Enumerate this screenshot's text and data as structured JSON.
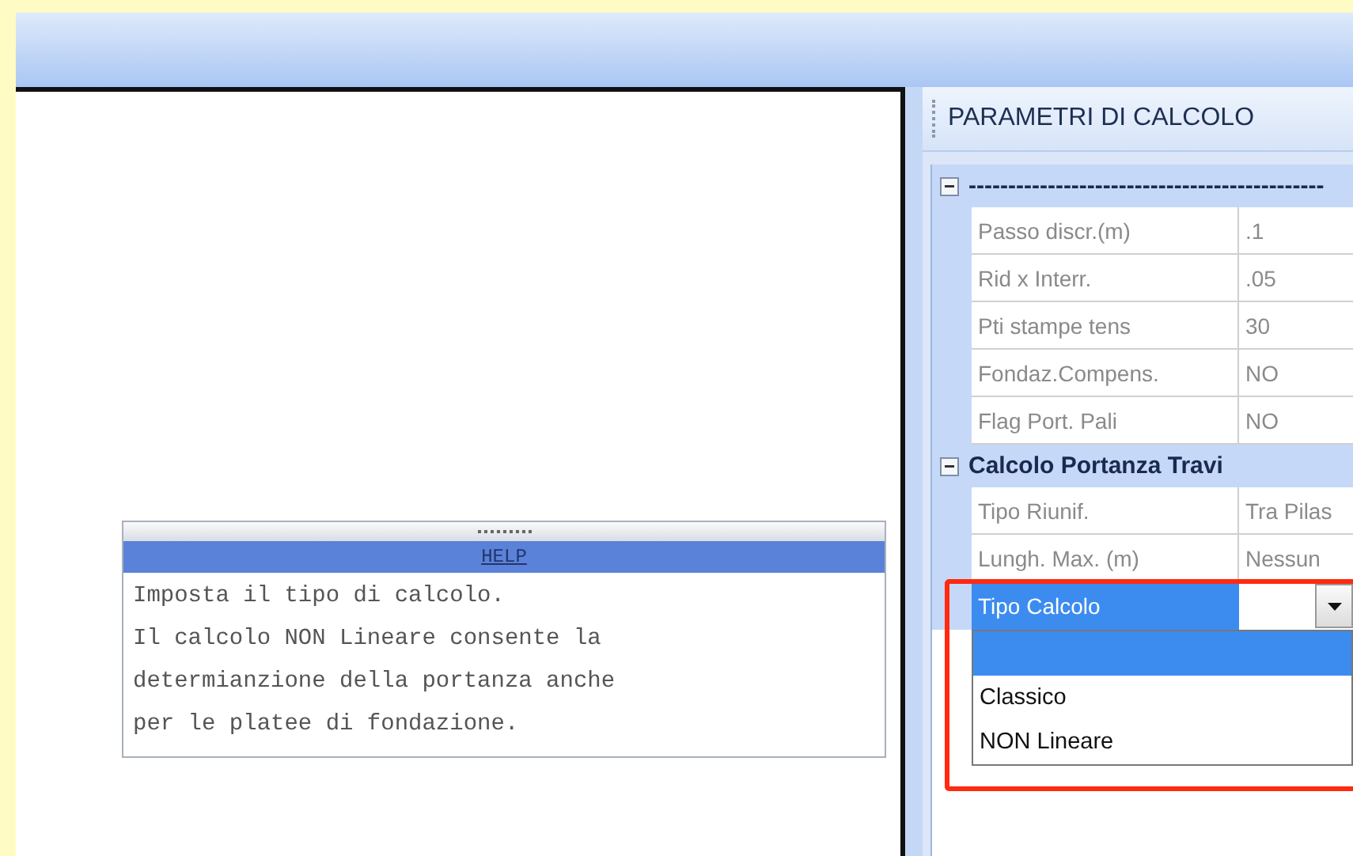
{
  "panel": {
    "title": "PARAMETRI DI CALCOLO"
  },
  "groups": [
    {
      "title": "---------------------------------------------",
      "expanded": true,
      "rows": [
        {
          "kind": "property",
          "name": "Passo discr.(m)",
          "value": ".1"
        },
        {
          "kind": "property",
          "name": "Rid x Interr.",
          "value": ".05"
        },
        {
          "kind": "property",
          "name": "Pti stampe tens",
          "value": "30"
        },
        {
          "kind": "property",
          "name": "Fondaz.Compens.",
          "value": "NO"
        },
        {
          "kind": "property",
          "name": "Flag Port. Pali",
          "value": "NO"
        }
      ]
    },
    {
      "title": "Calcolo Portanza Travi",
      "expanded": true,
      "rows": [
        {
          "kind": "property",
          "name": "Tipo Riunif.",
          "value": "Tra Pilas"
        },
        {
          "kind": "property",
          "name": "Lungh. Max. (m)",
          "value": "Nessun"
        },
        {
          "kind": "dropdown",
          "name": "Tipo Calcolo",
          "selected": true,
          "expanded": true,
          "options": [
            {
              "selected": true
            },
            {
              "label": "Classico",
              "selected": false
            },
            {
              "label": "NON Lineare",
              "selected": false
            }
          ]
        }
      ]
    }
  ],
  "help": {
    "title": "HELP",
    "lines": [
      "Imposta il tipo di calcolo.",
      "Il calcolo NON Lineare consente la",
      "determianzione della portanza anche",
      "per le platee di fondazione."
    ]
  }
}
